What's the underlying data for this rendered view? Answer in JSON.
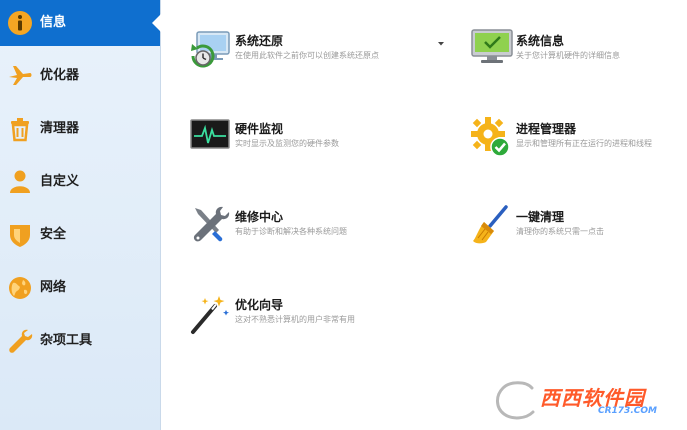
{
  "sidebar": {
    "items": [
      {
        "label": "信息",
        "icon": "info-icon",
        "active": true
      },
      {
        "label": "优化器",
        "icon": "airplane-icon",
        "active": false
      },
      {
        "label": "清理器",
        "icon": "trash-icon",
        "active": false
      },
      {
        "label": "自定义",
        "icon": "person-icon",
        "active": false
      },
      {
        "label": "安全",
        "icon": "shield-icon",
        "active": false
      },
      {
        "label": "网络",
        "icon": "globe-icon",
        "active": false
      },
      {
        "label": "杂项工具",
        "icon": "wrench-icon",
        "active": false
      }
    ]
  },
  "tools": [
    {
      "title": "系统还原",
      "desc": "在使用此软件之前你可以创建系统还原点",
      "icon": "system-restore-icon"
    },
    {
      "title": "系统信息",
      "desc": "关于您计算机硬件的详细信息",
      "icon": "monitor-icon"
    },
    {
      "title": "硬件监视",
      "desc": "实时显示及监测您的硬件参数",
      "icon": "heartbeat-monitor-icon"
    },
    {
      "title": "进程管理器",
      "desc": "显示和管理所有正在运行的进程和线程",
      "icon": "gear-check-icon"
    },
    {
      "title": "维修中心",
      "desc": "有助于诊断和解决各种系统问题",
      "icon": "wrench-screwdriver-icon"
    },
    {
      "title": "一键清理",
      "desc": "清理你的系统只需一点击",
      "icon": "broom-icon"
    },
    {
      "title": "优化向导",
      "desc": "这对不熟悉计算机的用户非常有用",
      "icon": "magic-wand-icon"
    }
  ],
  "watermark": {
    "text": "西西软件园",
    "sub": "CR173.COM"
  },
  "colors": {
    "accent": "#0f6fcf",
    "sidebar_bg": "#e2edf8",
    "icon_orange": "#f5a623"
  }
}
